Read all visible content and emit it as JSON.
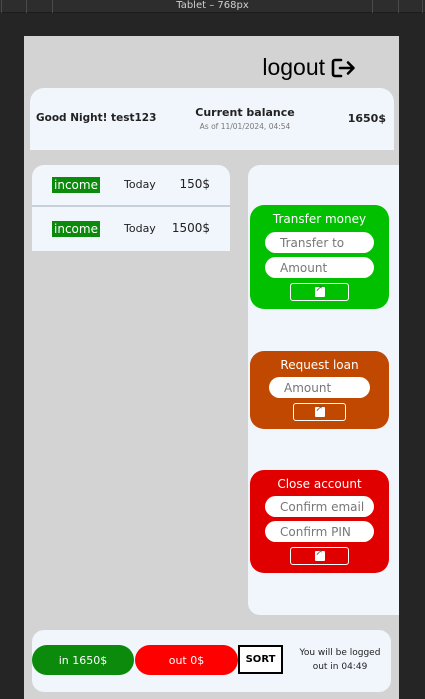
{
  "editor": {
    "frame_title": "Tablet – 768px"
  },
  "header": {
    "logout_label": "logout"
  },
  "summary": {
    "greeting": "Good Night! test123",
    "balance_label": "Current balance",
    "balance_date": "As of 11/01/2024, 04:54",
    "balance_value": "1650$"
  },
  "movements": [
    {
      "type": "income",
      "date": "Today",
      "amount": "150$"
    },
    {
      "type": "income",
      "date": "Today",
      "amount": "1500$"
    }
  ],
  "operations": {
    "transfer": {
      "title": "Transfer money",
      "to_placeholder": "Transfer to",
      "amount_placeholder": "Amount"
    },
    "loan": {
      "title": "Request loan",
      "amount_placeholder": "Amount"
    },
    "close": {
      "title": "Close account",
      "email_placeholder": "Confirm email",
      "pin_placeholder": "Confirm PIN"
    }
  },
  "footer": {
    "in_label": "in 1650$",
    "out_label": "out 0$",
    "sort_label": "SORT",
    "timer_text": "You will be logged out in 04:49"
  },
  "colors": {
    "income": "#0b8a0b",
    "transfer": "#00c000",
    "loan": "#c04800",
    "close": "#e00000",
    "out": "#ff0000",
    "panel": "#f0f6fc",
    "background": "#d3d3d3"
  }
}
